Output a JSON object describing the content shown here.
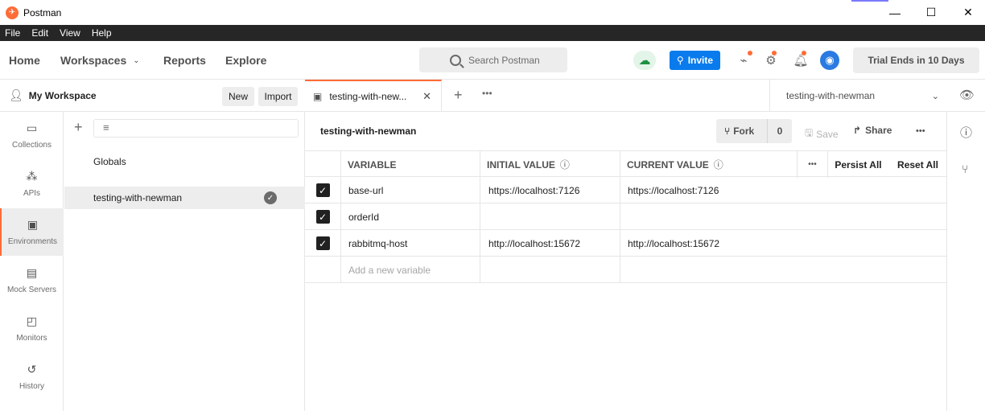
{
  "app": {
    "title": "Postman"
  },
  "menu": [
    "File",
    "Edit",
    "View",
    "Help"
  ],
  "header": {
    "home": "Home",
    "workspaces": "Workspaces",
    "reports": "Reports",
    "explore": "Explore",
    "search_placeholder": "Search Postman",
    "invite": "Invite",
    "trial": "Trial Ends in 10 Days"
  },
  "workspace": {
    "title": "My Workspace",
    "new_label": "New",
    "import_label": "Import"
  },
  "rail": [
    {
      "label": "Collections"
    },
    {
      "label": "APIs"
    },
    {
      "label": "Environments"
    },
    {
      "label": "Mock Servers"
    },
    {
      "label": "Monitors"
    },
    {
      "label": "History"
    }
  ],
  "env_list": [
    {
      "label": "Globals"
    },
    {
      "label": "testing-with-newman"
    }
  ],
  "tab": {
    "label": "testing-with-new..."
  },
  "env_selector": "testing-with-newman",
  "editor": {
    "title": "testing-with-newman",
    "fork": "Fork",
    "fork_count": "0",
    "save": "Save",
    "share": "Share",
    "headers": {
      "variable": "VARIABLE",
      "initial": "INITIAL VALUE",
      "current": "CURRENT VALUE",
      "persist": "Persist All",
      "reset": "Reset All"
    },
    "rows": [
      {
        "variable": "base-url",
        "initial": "https://localhost:7126",
        "current": "https://localhost:7126"
      },
      {
        "variable": "orderId",
        "initial": "",
        "current": ""
      },
      {
        "variable": "rabbitmq-host",
        "initial": "http://localhost:15672",
        "current": "http://localhost:15672"
      }
    ],
    "add_placeholder": "Add a new variable"
  },
  "colors": {
    "accent": "#ff6c37",
    "invite_blue": "#097bed"
  }
}
